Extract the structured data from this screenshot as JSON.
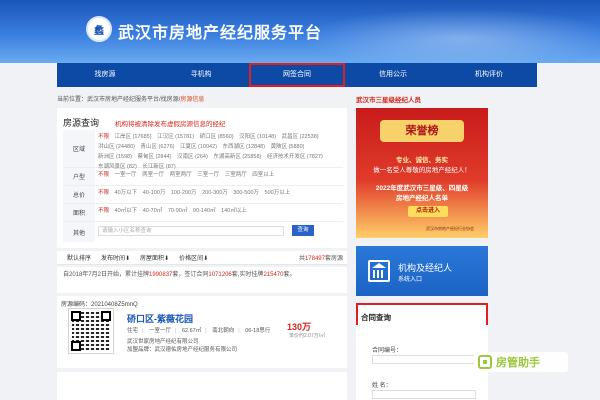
{
  "header": {
    "logo_char": "蠡",
    "site_title": "武汉市房地产经纪服务平台"
  },
  "nav": {
    "items": [
      {
        "label": "找房源"
      },
      {
        "label": "寻机构"
      },
      {
        "label": "网签合同"
      },
      {
        "label": "信用公示"
      },
      {
        "label": "机构评价"
      }
    ]
  },
  "breadcrumb": {
    "prefix": "当前位置：武汉市房地产经纪服务平台/找房源/",
    "current": "房源信息"
  },
  "search_panel": {
    "title": "房源查询",
    "warning": "机构将被清除发布虚假房源信息的经纪",
    "district": {
      "label": "区域",
      "options": [
        "不限",
        "江岸区 (17685)",
        "江汉区 (15781)",
        "硚口区 (8560)",
        "汉阳区 (10148)",
        "武昌区 (22538)",
        "洪山区 (24480)",
        "青山区 (6276)",
        "江夏区 (10042)",
        "东西湖区 (12848)",
        "黄陂区 (5880)",
        "新洲区 (1598)",
        "蔡甸区 (2844)",
        "汉南区 (264)",
        "东湖高新区 (25858)",
        "经济技术开发区 (7827)",
        "东湖风景区 (82)",
        "长江新区 (87)"
      ]
    },
    "layout": {
      "label": "户型",
      "options": [
        "不限",
        "一室一厅",
        "两室一厅",
        "两室两厅",
        "三室一厅",
        "三室两厅",
        "四室以上"
      ]
    },
    "price": {
      "label": "总价",
      "options": [
        "不限",
        "40万以下",
        "40-100万",
        "100-200万",
        "200-300万",
        "300-500万",
        "500万以上"
      ]
    },
    "area": {
      "label": "面积",
      "options": [
        "不限",
        "40㎡以下",
        "40-70㎡",
        "70-90㎡",
        "90-140㎡",
        "140㎡以上"
      ]
    },
    "other": {
      "label": "其他",
      "placeholder": "请输入小区名称查询",
      "button": "查询"
    }
  },
  "sort_bar": {
    "items": [
      "默认排序",
      "发布时间⬇",
      "房屋面积⬇",
      "价格区间⬇"
    ],
    "total_prefix": "共",
    "total_count": "178497",
    "total_suffix": "套房源"
  },
  "notice": {
    "part1": "自2018年7月2日开始，累计挂牌",
    "count1": "1990837",
    "part2": "套，签订合同",
    "count2": "1071206",
    "part3": "套,实时挂牌",
    "count3": "215470",
    "part4": "套。"
  },
  "listing": {
    "code": "房源编码：20210408Z5mnQ",
    "name": "硚口区-紫薇花园",
    "tags": [
      "住宅",
      "一室一厅",
      "62.67㎡",
      "南北朝向",
      "06-18思行"
    ],
    "agency1": "武汉世家房地产经纪有限公司",
    "agency2": "加盟品牌：武汉德佑房地产经纪服务有限公司",
    "price": "130万",
    "unit_price": "单价约2.07万/㎡"
  },
  "right": {
    "title": "武汉市三星级经纪人员",
    "banner": {
      "badge": "荣誉榜",
      "line1": "专业、诚信、务实",
      "line2": "做一名受人尊敬的房地产经纪人！",
      "line3": "2022年度武汉市三星级、四星级",
      "line4": "房地产经纪人名单",
      "go": "点击进入",
      "foot": "武汉市房地产经纪行业协会"
    },
    "agency": {
      "title": "机构及经纪人",
      "subtitle": "系统入口"
    },
    "contract": {
      "title": "合同查询",
      "label1": "合同编号：",
      "label2": "姓    名："
    }
  },
  "watermark": {
    "text": "房管助手"
  },
  "colors": {
    "nav": "#0d4aa6",
    "accent_red": "#d6261b",
    "link_blue": "#1a56b8"
  }
}
